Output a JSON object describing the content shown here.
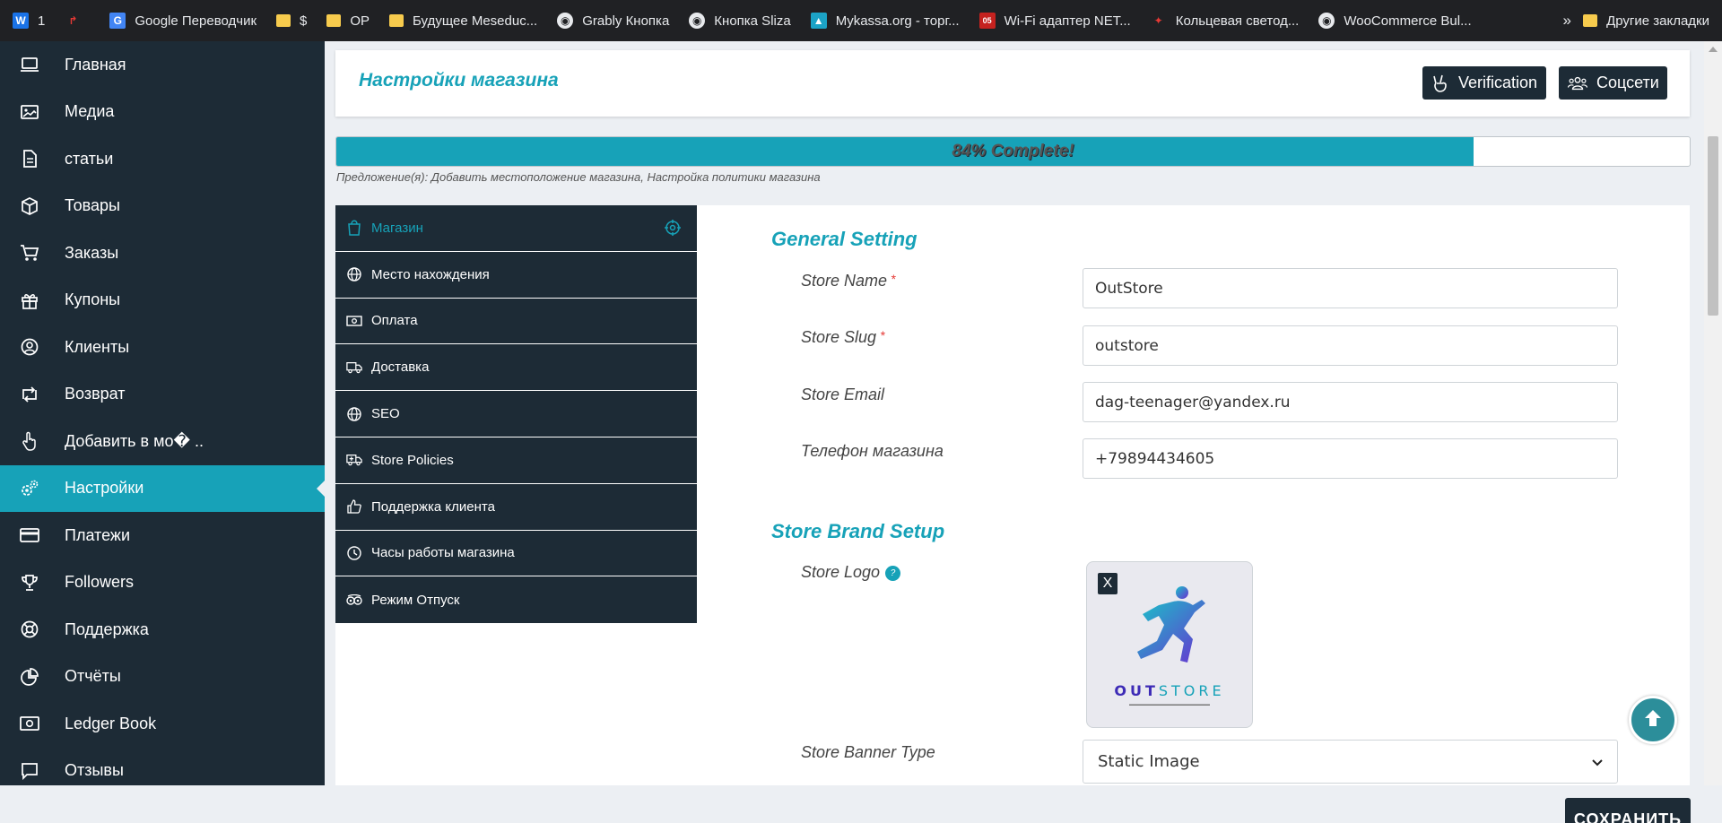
{
  "bookmarks": {
    "items": [
      {
        "label": "1",
        "icon": "wordpress-icon"
      },
      {
        "label": "",
        "icon": "star-bookmark-icon"
      },
      {
        "label": "Google Переводчик",
        "icon": "google-translate-icon"
      },
      {
        "label": "$",
        "icon": "folder-icon"
      },
      {
        "label": "OP",
        "icon": "folder-icon"
      },
      {
        "label": "Будущее Meseduc...",
        "icon": "folder-icon"
      },
      {
        "label": "Grably Кнопка",
        "icon": "globe-icon"
      },
      {
        "label": "Кнопка Sliza",
        "icon": "globe-icon"
      },
      {
        "label": "Mykassa.org - торг...",
        "icon": "shopping-bag-icon"
      },
      {
        "label": "Wi-Fi адаптер NET...",
        "icon": "red-site-icon"
      },
      {
        "label": "Кольцевая светод...",
        "icon": "site-icon"
      },
      {
        "label": "WooCommerce Bul...",
        "icon": "globe-icon"
      }
    ],
    "more": "»",
    "other": "Другие закладки"
  },
  "sidebar": {
    "items": [
      {
        "label": "Главная",
        "icon": "monitor-icon"
      },
      {
        "label": "Медиа",
        "icon": "image-icon"
      },
      {
        "label": "статьи",
        "icon": "document-icon"
      },
      {
        "label": "Товары",
        "icon": "cube-icon"
      },
      {
        "label": "Заказы",
        "icon": "cart-icon"
      },
      {
        "label": "Купоны",
        "icon": "gift-icon"
      },
      {
        "label": "Клиенты",
        "icon": "user-circle-icon"
      },
      {
        "label": "Возврат",
        "icon": "retweet-icon"
      },
      {
        "label": "Добавить в мо� ..",
        "icon": "hand-pointer-icon"
      },
      {
        "label": "Настройки",
        "icon": "cogs-icon",
        "active": true
      },
      {
        "label": "Платежи",
        "icon": "credit-card-icon"
      },
      {
        "label": "Followers",
        "icon": "trophy-icon"
      },
      {
        "label": "Поддержка",
        "icon": "life-ring-icon"
      },
      {
        "label": "Отчёты",
        "icon": "pie-chart-icon"
      },
      {
        "label": "Ledger Book",
        "icon": "money-icon"
      },
      {
        "label": "Отзывы",
        "icon": "comment-icon"
      }
    ]
  },
  "header": {
    "title": "Настройки магазина",
    "verification_label": "Verification",
    "social_label": "Соцсети"
  },
  "progress": {
    "value": 0.84,
    "label": "84% Complete!",
    "suggestion": "Предложение(я): Добавить местоположение магазина, Настройка политики магазина"
  },
  "tabs": [
    {
      "label": "Магазин",
      "icon": "shopping-bag-icon",
      "active": true
    },
    {
      "label": "Место нахождения",
      "icon": "globe-icon"
    },
    {
      "label": "Оплата",
      "icon": "money-bill-icon"
    },
    {
      "label": "Доставка",
      "icon": "truck-icon"
    },
    {
      "label": "SEO",
      "icon": "globe-icon"
    },
    {
      "label": "Store Policies",
      "icon": "ambulance-icon"
    },
    {
      "label": "Поддержка клиента",
      "icon": "thumbs-up-icon"
    },
    {
      "label": "Часы работы магазина",
      "icon": "clock-icon"
    },
    {
      "label": "Режим Отпуск",
      "icon": "tripadvisor-icon"
    }
  ],
  "general": {
    "title": "General Setting",
    "store_name_label": "Store Name",
    "store_name": "OutStore",
    "store_slug_label": "Store Slug",
    "store_slug": "outstore",
    "store_email_label": "Store Email",
    "store_email": "dag-teenager@yandex.ru",
    "store_phone_label": "Телефон магазина",
    "store_phone": "+79894434605",
    "required_mark": "*"
  },
  "brand": {
    "title": "Store Brand Setup",
    "logo_label": "Store Logo",
    "logo_remove": "X",
    "logo_text_bold": "OUT",
    "logo_text_light": "STORE",
    "banner_type_label": "Store Banner Type",
    "banner_type_value": "Static Image"
  },
  "footer": {
    "save_label": "СОХРАНИТЬ"
  },
  "colors": {
    "accent": "#17a2b8",
    "dark": "#1d2b36"
  }
}
